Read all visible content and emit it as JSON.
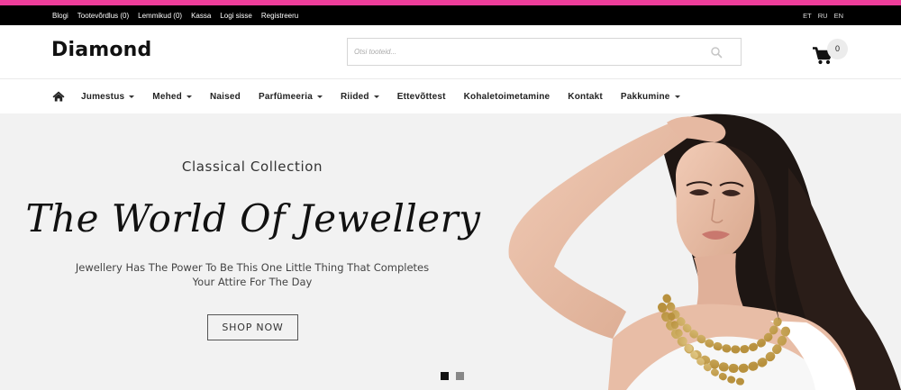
{
  "colors": {
    "accent": "#ee3e9b",
    "topbar": "#000000",
    "hero_bg": "#f2f2f2"
  },
  "topbar": {
    "links": [
      "Blogi",
      "Tootevõrdlus (0)",
      "Lemmikud (0)",
      "Kassa",
      "Logi sisse",
      "Registreeru"
    ],
    "languages": [
      "ET",
      "RU",
      "EN"
    ]
  },
  "header": {
    "logo": "Diamond",
    "search": {
      "placeholder": "Otsi tooteid...",
      "value": "",
      "icon": "search-icon"
    },
    "cart": {
      "icon": "cart-icon",
      "count": "0"
    }
  },
  "nav": {
    "home_icon": "home-icon",
    "items": [
      {
        "label": "Jumestus",
        "dropdown": true
      },
      {
        "label": "Mehed",
        "dropdown": true
      },
      {
        "label": "Naised",
        "dropdown": false
      },
      {
        "label": "Parfümeeria",
        "dropdown": true
      },
      {
        "label": "Riided",
        "dropdown": true
      },
      {
        "label": "Ettevõttest",
        "dropdown": false
      },
      {
        "label": "Kohaletoimetamine",
        "dropdown": false
      },
      {
        "label": "Kontakt",
        "dropdown": false
      },
      {
        "label": "Pakkumine",
        "dropdown": true
      }
    ]
  },
  "hero": {
    "subtitle": "Classical Collection",
    "headline": "The World Of Jewellery",
    "description_line1": "Jewellery Has The Power To Be This One Little Thing That Completes",
    "description_line2": "Your Attire For The Day",
    "button": "SHOP NOW",
    "slides": {
      "total": 2,
      "active": 1
    }
  }
}
